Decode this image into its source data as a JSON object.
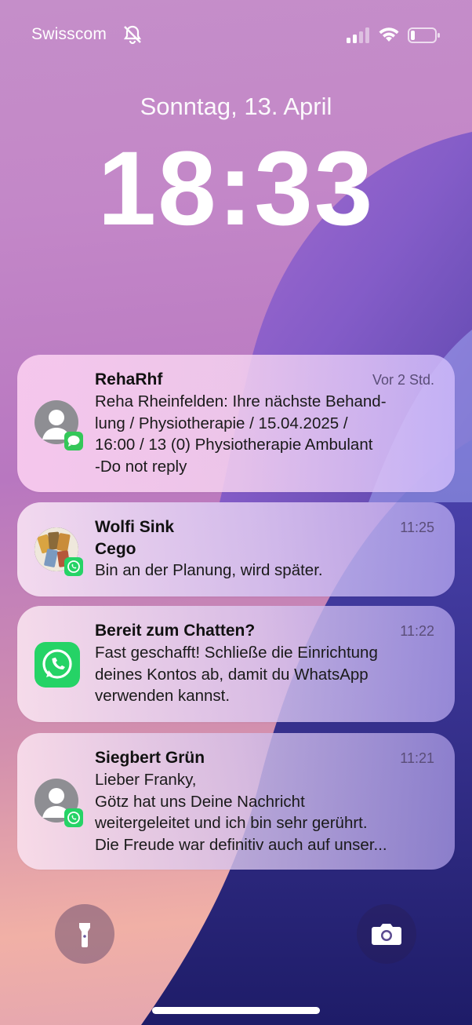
{
  "status_bar": {
    "carrier": "Swisscom"
  },
  "lock_screen": {
    "date": "Sonntag, 13. April",
    "time": "18:33"
  },
  "notifications": [
    {
      "app": "messages",
      "title": "RehaRhf",
      "timestamp": "Vor 2 Std.",
      "body": "Reha Rheinfelden: Ihre nächste Behand-\nlung / Physiotherapie / 15.04.2025 /\n16:00 / 13 (0) Physiotherapie Ambulant\n-Do not reply"
    },
    {
      "app": "whatsapp",
      "title": "Wolfi Sink",
      "subtitle": "Cego",
      "timestamp": "11:25",
      "body": "Bin an der Planung, wird später."
    },
    {
      "app": "whatsapp",
      "title": "Bereit zum Chatten?",
      "timestamp": "11:22",
      "body": "Fast geschafft! Schließe die Einrichtung\ndeines Kontos ab, damit du WhatsApp\nverwenden kannst."
    },
    {
      "app": "whatsapp",
      "title": "Siegbert Grün",
      "timestamp": "11:21",
      "body": "Lieber Franky,\nGötz hat uns Deine Nachricht\nweitergeleitet und ich bin sehr gerührt.\nDie Freude war definitiv auch auf unser..."
    }
  ],
  "quick_actions": {
    "left": "flashlight-icon",
    "right": "camera-icon"
  },
  "colors": {
    "whatsapp_green": "#25d366",
    "messages_green": "#34c759"
  }
}
